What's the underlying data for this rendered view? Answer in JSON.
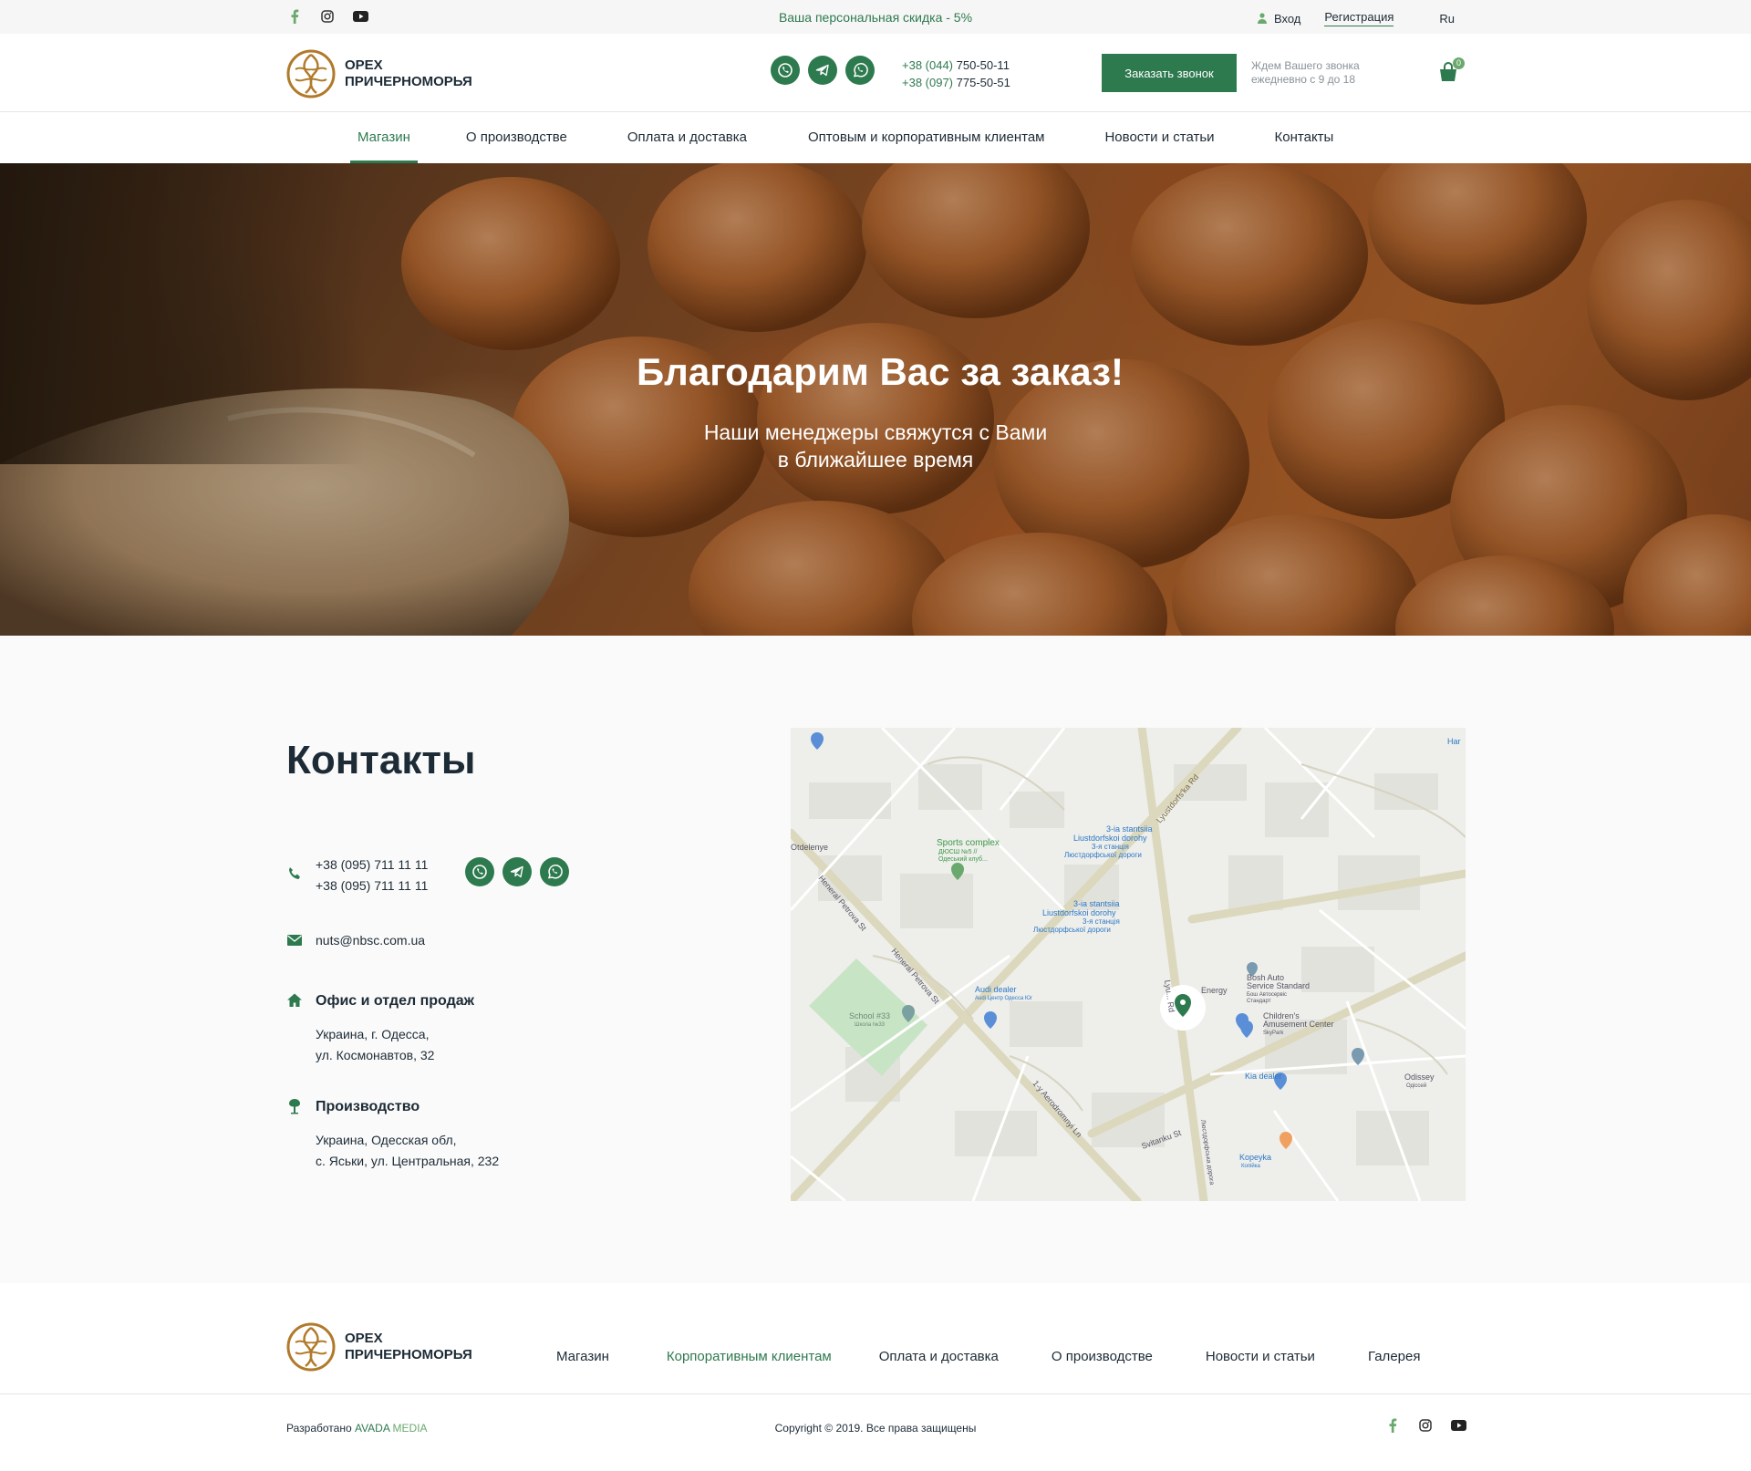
{
  "topbar": {
    "discount": "Ваша персональная скидка - 5%",
    "login": "Вход",
    "register": "Регистрация",
    "lang": "Ru",
    "socials": [
      "facebook-icon",
      "instagram-icon",
      "youtube-icon"
    ]
  },
  "header": {
    "brand_line1": "ОРЕХ",
    "brand_line2": "ПРИЧЕРНОМОРЬЯ",
    "phone1_code": "+38 (044)",
    "phone1_num": " 750-50-11",
    "phone2_code": "+38 (097)",
    "phone2_num": " 775-50-51",
    "call_button": "Заказать звонок",
    "call_note1": "Ждем Вашего звонка",
    "call_note2": "ежедневно с 9 до 18",
    "cart_count": "0"
  },
  "nav": [
    "Магазин",
    "О производстве",
    "Оплата и доставка",
    "Оптовым и корпоративным клиентам",
    "Новости и статьи",
    "Контакты"
  ],
  "hero": {
    "title": "Благодарим Вас за заказ!",
    "subtitle1": "Наши менеджеры свяжутся с Вами",
    "subtitle2": "в ближайшее время"
  },
  "contacts": {
    "heading": "Контакты",
    "phone1": "+38 (095) 711 11 11",
    "phone2": "+38 (095) 711 11 11",
    "email": "nuts@nbsc.com.ua",
    "office_title": "Офис и отдел продаж",
    "office_line1": "Украина, г. Одесса,",
    "office_line2": "ул. Космонавтов, 32",
    "prod_title": "Производство",
    "prod_line1": "Украина, Одесская обл,",
    "prod_line2": "с. Яськи, ул. Центральная, 232"
  },
  "map_labels": {
    "sports": "Sports complex",
    "sports2": "ДЮСШ №5 //",
    "sports3": "Одеський клуб...",
    "station1": "3-ia stantsiia",
    "station1b": "Liustdorfskoi dorohy",
    "station1c": "3-я станція",
    "station1d": "Люстдорфської дороги",
    "station2": "3-ia stantsiia",
    "station2b": "Liustdorfskoi dorohy",
    "station2c": "3-я станція",
    "station2d": "Люстдорфської дороги",
    "audi": "Audi dealer",
    "audi2": "Audi Центр Одесса Юг",
    "school": "School #33",
    "school2": "Школа №33",
    "bosh": "Bosh Auto",
    "bosh2": "Service Standard",
    "bosh3": "Бош Автосервіс",
    "bosh4": "Стандарт",
    "energy": "Energy",
    "children": "Children's",
    "children2": "Amusement Center",
    "children3": "SkyPark",
    "kia": "Kia dealer",
    "odissey": "Odissey",
    "odissey2": "Одіссей",
    "kopeyka": "Kopeyka",
    "kopeyka2": "Копійка",
    "road1": "Lyustdorfs'ka Rd",
    "road2": "Heneral Petrova St",
    "road3": "Heneral Petrova St",
    "road4": "1-y Aerodromnyi Ln",
    "road5": "Svitanku St",
    "road6": "Lyu... Rd",
    "road7": "Люстдорфська дорога",
    "edge1": "Otdelenye",
    "edge2": "Har"
  },
  "footer": {
    "brand_line1": "ОРЕХ",
    "brand_line2": "ПРИЧЕРНОМОРЬЯ",
    "nav": [
      "Магазин",
      "Корпоративным клиентам",
      "Оплата и доставка",
      "О производстве",
      "Новости и статьи",
      "Галерея"
    ],
    "dev_prefix": "Разработано ",
    "dev_name1": "AVADA",
    "dev_name2": " MEDIA",
    "copyright": "Copyright © 2019. Все права защищены"
  },
  "colors": {
    "accent": "#2e7a4f",
    "logo": "#b07a2a",
    "text": "#1d2b36"
  }
}
